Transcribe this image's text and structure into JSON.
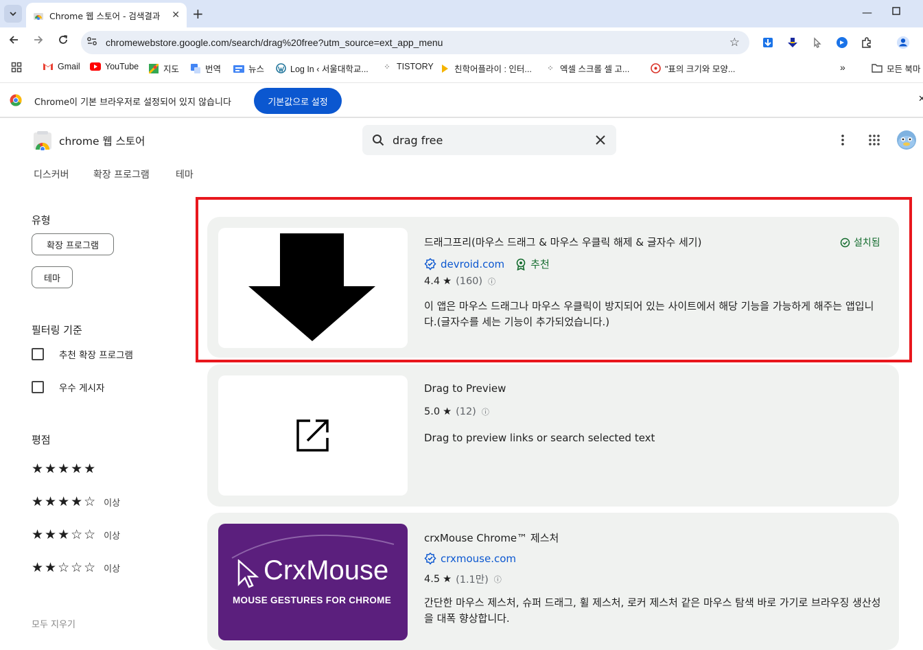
{
  "browser": {
    "tab_title": "Chrome 웹 스토어 - 검색결과",
    "url": "chromewebstore.google.com/search/drag%20free?utm_source=ext_app_menu"
  },
  "bookmarks": [
    {
      "label": "Gmail",
      "icon": "gmail-icon"
    },
    {
      "label": "YouTube",
      "icon": "youtube-icon"
    },
    {
      "label": "지도",
      "icon": "maps-icon"
    },
    {
      "label": "번역",
      "icon": "translate-icon"
    },
    {
      "label": "뉴스",
      "icon": "news-icon"
    },
    {
      "label": "Log In ‹ 서울대학교...",
      "icon": "wordpress-icon"
    },
    {
      "label": "TISTORY",
      "icon": "tistory-icon"
    },
    {
      "label": "친학어플라이 : 인터...",
      "icon": "arrow-icon"
    },
    {
      "label": "엑셀 스크롤 셀 고...",
      "icon": "tistory-icon"
    },
    {
      "label": "\"표의 크기와 모양...",
      "icon": "hangul-icon"
    }
  ],
  "bookmarks_folder": "모든 북마",
  "infobar": {
    "message": "Chrome이 기본 브라우저로 설정되어 있지 않습니다",
    "button": "기본값으로 설정"
  },
  "store": {
    "title": "chrome 웹 스토어",
    "search_query": "drag free",
    "nav": [
      "디스커버",
      "확장 프로그램",
      "테마"
    ]
  },
  "sidebar": {
    "type_heading": "유형",
    "type_chips": [
      "확장 프로그램",
      "테마"
    ],
    "filter_heading": "필터링 기준",
    "filters": [
      "추천 확장 프로그램",
      "우수 게시자"
    ],
    "rating_heading": "평점",
    "ratings": [
      {
        "stars": "★★★★★",
        "suffix": ""
      },
      {
        "stars": "★★★★☆",
        "suffix": "이상"
      },
      {
        "stars": "★★★☆☆",
        "suffix": "이상"
      },
      {
        "stars": "★★☆☆☆",
        "suffix": "이상"
      }
    ],
    "clear": "모두 지우기"
  },
  "results": [
    {
      "title": "드래그프리(마우스 드래그 & 마우스 우클릭 해제 & 글자수 세기)",
      "installed": "설치됨",
      "publisher": "devroid.com",
      "badge": "추천",
      "rating": "4.4",
      "count": "(160)",
      "description": "이 앱은 마우스 드래그나 마우스 우클릭이 방지되어 있는 사이트에서 해당 기능을 가능하게 해주는 앱입니다.(글자수를 세는 기능이 추가되었습니다.)"
    },
    {
      "title": "Drag to Preview",
      "rating": "5.0",
      "count": "(12)",
      "description": "Drag to preview links or search selected text"
    },
    {
      "title": "crxMouse Chrome™ 제스처",
      "publisher": "crxmouse.com",
      "rating": "4.5",
      "count": "(1.1만)",
      "logo_text": "CrxMouse",
      "logo_sub": "MOUSE GESTURES FOR CHROME",
      "description": "간단한 마우스 제스처, 슈퍼 드래그, 휠 제스처, 로커 제스처 같은 마우스 탐색 바로 가기로 브라우징 생산성을 대폭 향상합니다."
    }
  ],
  "colors": {
    "accent": "#0b57d0",
    "highlight": "#e8171d",
    "crxmouse_bg": "#5b1f7d",
    "installed": "#146c2e"
  }
}
